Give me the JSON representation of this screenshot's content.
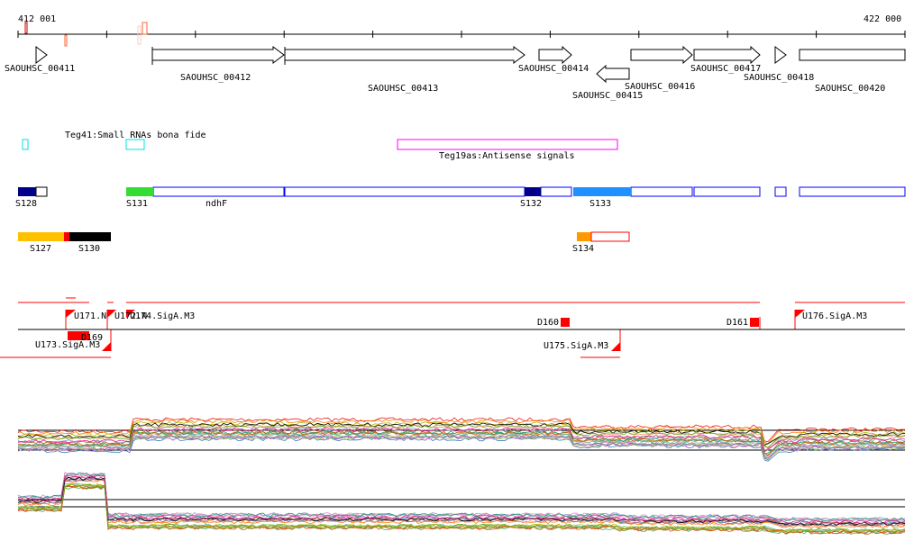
{
  "ruler": {
    "start": "412 001",
    "end": "422 000"
  },
  "genes": [
    "SAOUHSC_00411",
    "SAOUHSC_00412",
    "SAOUHSC_00413",
    "SAOUHSC_00414",
    "SAOUHSC_00415",
    "SAOUHSC_00416",
    "SAOUHSC_00417",
    "SAOUHSC_00418",
    "SAOUHSC_00420"
  ],
  "rna_tracks": {
    "small_rnas": "Teg41:Small RNAs bona fide",
    "antisense": "Teg19as:Antisense signals"
  },
  "segments": {
    "s128": "S128",
    "s131": "S131",
    "ndhf": "ndhF",
    "s132": "S132",
    "s133": "S133",
    "s127": "S127",
    "s130": "S130",
    "s134": "S134"
  },
  "sites": {
    "u171": "U171.N",
    "u172": "U172.N",
    "u174": "U174.SigA.M3",
    "u169": "D169",
    "u173": "U173.SigA.M3",
    "d160": "D160",
    "d161": "D161",
    "u175": "U175.SigA.M3",
    "u176": "U176.SigA.M3"
  },
  "colors": {
    "navy": "#00008b",
    "green": "#33dd33",
    "blue": "#1e90ff",
    "gold": "#ffc000",
    "orange": "#ff9900",
    "red": "#ff0000",
    "magenta": "#ff00ff",
    "cyan": "#00e0e0"
  }
}
